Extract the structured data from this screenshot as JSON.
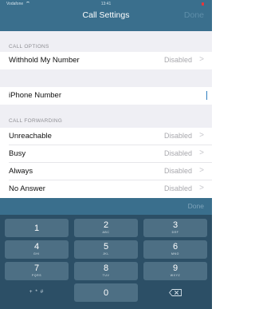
{
  "status": {
    "carrier": "Vodafone",
    "time": "13:41"
  },
  "nav": {
    "title": "Call Settings",
    "done_label": "Done"
  },
  "sections": {
    "call_options_header": "CALL OPTIONS",
    "call_forwarding_header": "CALL FORWARDING"
  },
  "rows": {
    "withhold": {
      "label": "Withhold My Number",
      "value": "Disabled"
    },
    "iphone_number": {
      "label": "iPhone Number",
      "value": ""
    },
    "unreachable": {
      "label": "Unreachable",
      "value": "Disabled"
    },
    "busy": {
      "label": "Busy",
      "value": "Disabled"
    },
    "always": {
      "label": "Always",
      "value": "Disabled"
    },
    "no_answer": {
      "label": "No Answer",
      "value": "Disabled"
    }
  },
  "chevron": ">",
  "keyboard": {
    "done_label": "Done",
    "keys": [
      {
        "digit": "1",
        "letters": ""
      },
      {
        "digit": "2",
        "letters": "ABC"
      },
      {
        "digit": "3",
        "letters": "DEF"
      },
      {
        "digit": "4",
        "letters": "GHI"
      },
      {
        "digit": "5",
        "letters": "JKL"
      },
      {
        "digit": "6",
        "letters": "MNO"
      },
      {
        "digit": "7",
        "letters": "PQRS"
      },
      {
        "digit": "8",
        "letters": "TUV"
      },
      {
        "digit": "9",
        "letters": "WXYZ"
      },
      {
        "digit": "+ * #",
        "letters": ""
      },
      {
        "digit": "0",
        "letters": ""
      },
      {
        "digit": "backspace",
        "letters": ""
      }
    ]
  },
  "colors": {
    "nav_bar": "#3a6f8d",
    "keyboard_bg": "#2c4f66",
    "key_bg": "#4d6f84",
    "value_text": "#a8a8ad",
    "cursor": "#2f7fc1",
    "battery": "#e8353a"
  },
  "icons": {
    "backspace": "backspace-icon",
    "wifi": "wifi-icon",
    "battery": "battery-icon"
  }
}
